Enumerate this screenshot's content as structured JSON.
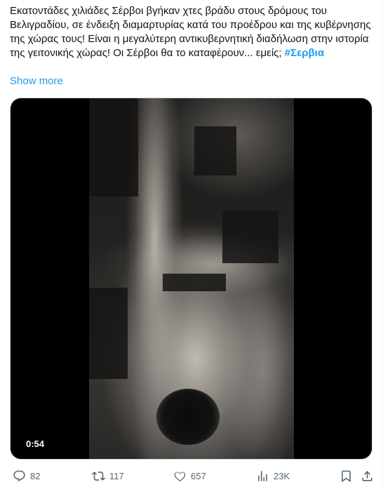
{
  "tweet": {
    "text": "Εκατοντάδες χιλιάδες Σέρβοι βγήκαν χτες βράδυ στους δρόμους του Βελιγραδίου, σε ένδειξη διαμαρτυρίας κατά του προέδρου και της κυβέρνησης της χώρας τους! Είναι η μεγαλύτερη αντικυβερνητική διαδήλωση στην ιστορία της γειτονικής χώρας! Οι Σέρβοι θα το καταφέρουν... εμείς; ",
    "hashtag": "#Σερβια",
    "show_more": "Show more"
  },
  "media": {
    "duration": "0:54"
  },
  "actions": {
    "replies": "82",
    "reposts": "117",
    "likes": "657",
    "views": "23K"
  },
  "colors": {
    "accent": "#1d9bf0",
    "muted": "#536471",
    "text": "#0f1419"
  }
}
